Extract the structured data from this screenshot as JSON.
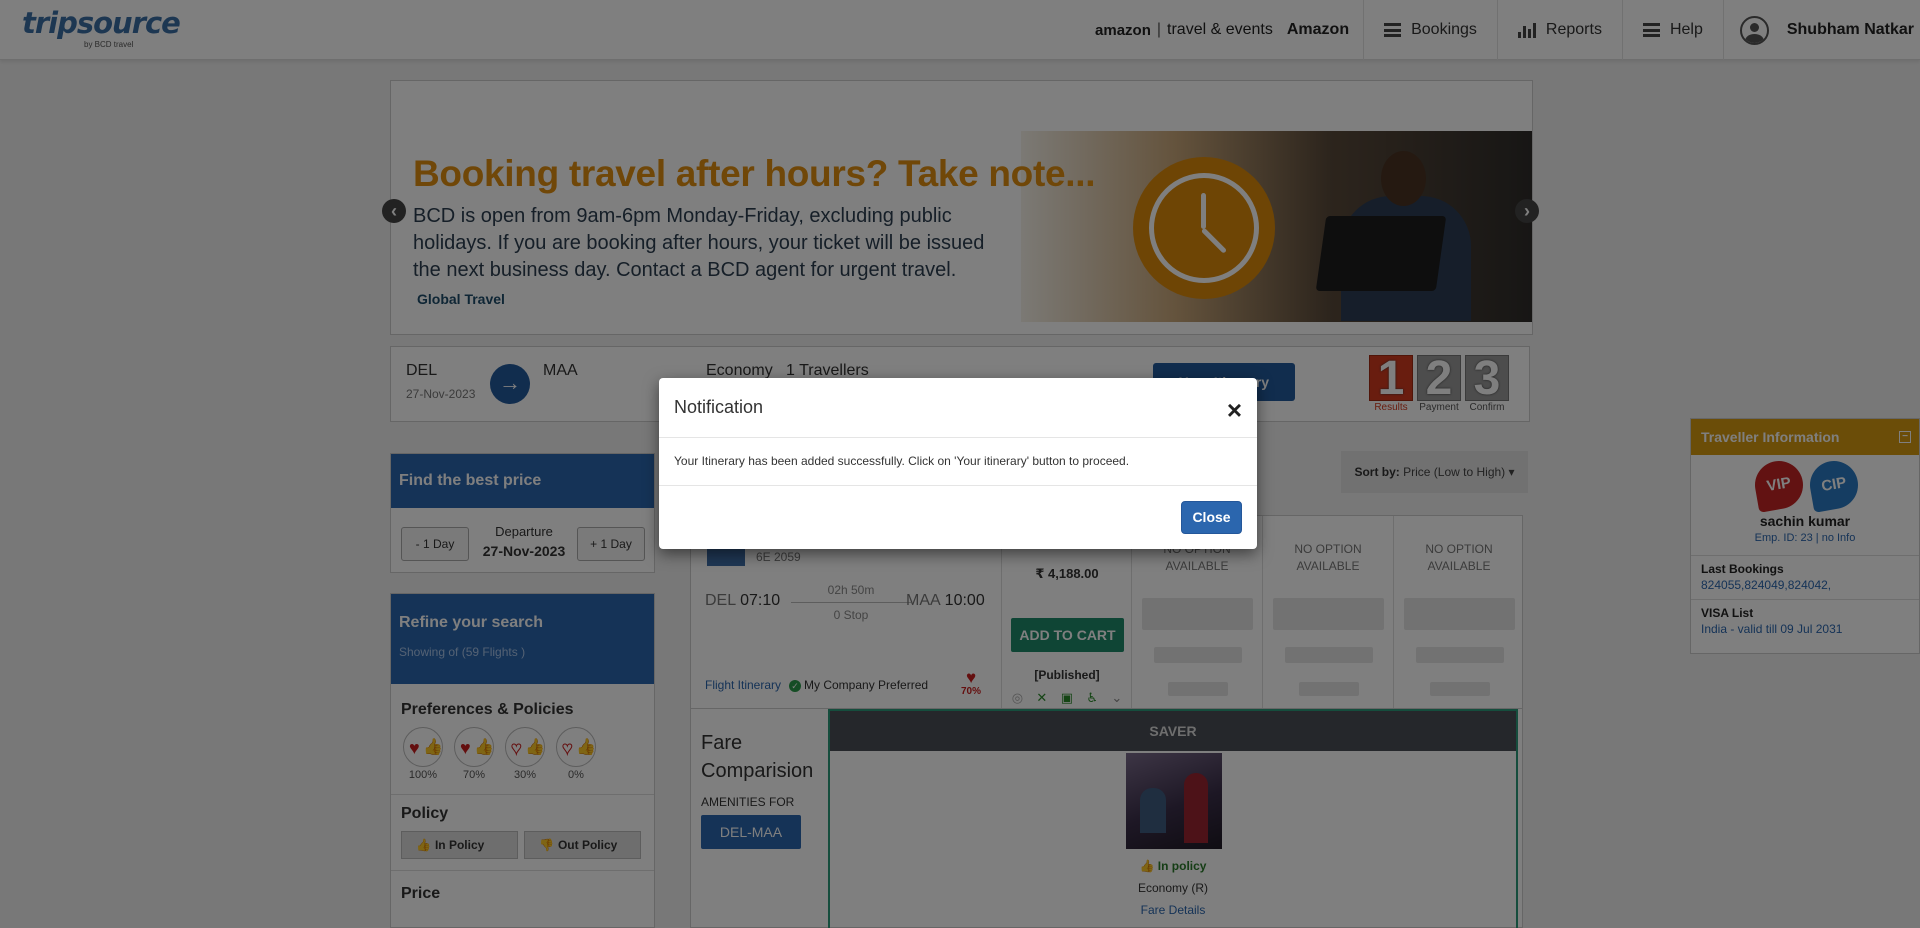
{
  "header": {
    "logo_main": "tripsource",
    "logo_sub": "by BCD travel",
    "brand_amazon": "amazon",
    "brand_divider": "|",
    "brand_travel": "travel & events",
    "company": "Amazon",
    "nav": [
      {
        "label": "Bookings",
        "icon": "list-icon"
      },
      {
        "label": "Reports",
        "icon": "bar-chart-icon"
      },
      {
        "label": "Help",
        "icon": "list-icon"
      }
    ],
    "user_name": "Shubham Natkar"
  },
  "banner": {
    "title": "Booking travel after hours? Take note...",
    "text": "BCD is open from 9am-6pm Monday-Friday, excluding public holidays. If you are booking after hours, your ticket will be issued the next business day. Contact a BCD agent for urgent travel.",
    "footer": "Global Travel",
    "prev_icon": "chevron-left-icon",
    "next_icon": "chevron-right-icon"
  },
  "search": {
    "from": "DEL",
    "date": "27-Nov-2023",
    "to": "MAA",
    "cabin": "Economy",
    "travellers": "1 Travellers",
    "itinerary_button": "Your Itinerary",
    "steps": [
      {
        "num": "1",
        "label": "Results",
        "active": true
      },
      {
        "num": "2",
        "label": "Payment",
        "active": false
      },
      {
        "num": "3",
        "label": "Confirm",
        "active": false
      }
    ]
  },
  "find_best": {
    "title": "Find the best price",
    "minus_day": "- 1 Day",
    "plus_day": "+ 1 Day",
    "departure_label": "Departure",
    "departure_date": "27-Nov-2023"
  },
  "refine": {
    "title": "Refine your search",
    "subtitle": "Showing of (59 Flights )",
    "preferences_title": "Preferences & Policies",
    "preferences": [
      {
        "pct": "100%",
        "filled": 1
      },
      {
        "pct": "70%",
        "filled": 0.7
      },
      {
        "pct": "30%",
        "filled": 0.3
      },
      {
        "pct": "0%",
        "filled": 0
      }
    ],
    "policy_title": "Policy",
    "in_policy": "In Policy",
    "out_policy": "Out Policy",
    "price_title": "Price"
  },
  "sort": {
    "label": "Sort by:",
    "value": "Price (Low to High)"
  },
  "flight": {
    "code": "6E 2059",
    "from_city": "DEL",
    "dep_time": "07:10",
    "duration": "02h 50m",
    "stops": "0 Stop",
    "to_city": "MAA",
    "arr_time": "10:00",
    "itinerary_link": "Flight Itinerary",
    "company_pref": "My Company Preferred",
    "pref_pct": "70%",
    "price": "₹ 4,188.00",
    "add_to_cart": "ADD TO CART",
    "fare_type": "[Published]",
    "no_option": "NO OPTION AVAILABLE"
  },
  "fare_compare": {
    "title": "Fare Comparision",
    "amenities_for": "AMENITIES FOR",
    "route": "DEL-MAA",
    "saver_label": "SAVER",
    "policy": "In policy",
    "cabin": "Economy (R)",
    "details_link": "Fare Details"
  },
  "traveller": {
    "title": "Traveller Information",
    "vip": "VIP",
    "cip": "CIP",
    "name": "sachin kumar",
    "emp": "Emp. ID: 23 | no Info",
    "last_bookings_label": "Last Bookings",
    "last_bookings": "824055,824049,824042,",
    "visa_label": "VISA List",
    "visa": "India - valid till 09 Jul 2031"
  },
  "modal": {
    "title": "Notification",
    "message": "Your Itinerary has been added successfully. Click on 'Your itinerary' button to proceed.",
    "close_button": "Close"
  },
  "colors": {
    "primary_blue": "#2b66ae",
    "add_cart_green": "#1e8a6a",
    "traveller_gold": "#d79a10",
    "step_active_red": "#d23a1f",
    "banner_orange": "#e08e10"
  }
}
